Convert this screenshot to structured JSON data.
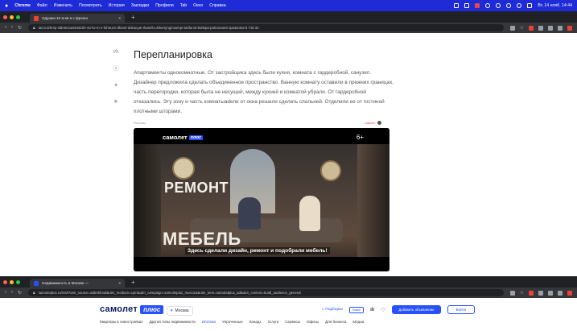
{
  "menubar": {
    "app": "Chrome",
    "items": [
      "Файл",
      "Изменить",
      "Посмотреть",
      "История",
      "Закладки",
      "Профили",
      "Tab",
      "Окно",
      "Справка"
    ],
    "clock": "Вт, 14 нояб. 14:44"
  },
  "browser1": {
    "tab_title": "Одушка 42 м кв и с фрэнш",
    "new_tab": "+",
    "url": "tad.ru/zkrsp-stdetectuntisrdctrh-42-kv-m-v-fuhtruzn-dkvart-dokunyar-rkasefu-dzkertyngmusmpr-tasfurva-butlnpa-potnomansi-qastuntsa-5 718 32"
  },
  "article": {
    "share_icons": [
      "vk-icon",
      "ok-icon",
      "twitter-icon",
      "telegram-icon"
    ],
    "title": "Перепланировка",
    "body": "Апартаменты однокомнатные. От застройщика здесь были кухня, комната с гардеробной, санузел. Дизайнер предложила сделать объединенное пространство. Ванную комнату оставили в прежних границах, часть перегородки, которая была не несущей, между кухней и комнатой убрали. От гардеробной отказались. Эту зону и часть комнатыadели от окна решили сделать спальней. Отделили ее от гостиной плотными шторами."
  },
  "ad": {
    "label": "Реклама",
    "brand": "самолет",
    "brand_tag": "плюс",
    "age": "6+",
    "headline1": "РЕМОНТ",
    "headline2": "МЕБЕЛЬ",
    "caption": "Здесь сделали дизайн, ремонт и подобрали мебель!"
  },
  "browser2": {
    "tab_title": "Недвижимость в Москве — ",
    "new_tab": "+",
    "url": "samoletplus.ru/msk?utm_source=adtrekfond&utm_medium=cpm&utm_campaign=samoletplus_moscow&utm_term=samoletplus_ad&utm_content=build_audience_general"
  },
  "site": {
    "logo_word": "самолет",
    "logo_badge": "плюс",
    "city": "Москва",
    "selection": "Подборки",
    "selection_badge": "Новое",
    "add_button": "Добавить объявление",
    "login": "Войти",
    "menu": [
      "Квартиры в новостройках",
      "Другая типы недвижимости",
      "Ипотека",
      "Упроченные",
      "Канадз",
      "Услуги",
      "Сервисы",
      "Офисы",
      "Для бизнеса",
      "Медиа"
    ]
  },
  "colors": {
    "menubar_bg": "#1f2bd6",
    "brand_blue": "#2750ff"
  }
}
